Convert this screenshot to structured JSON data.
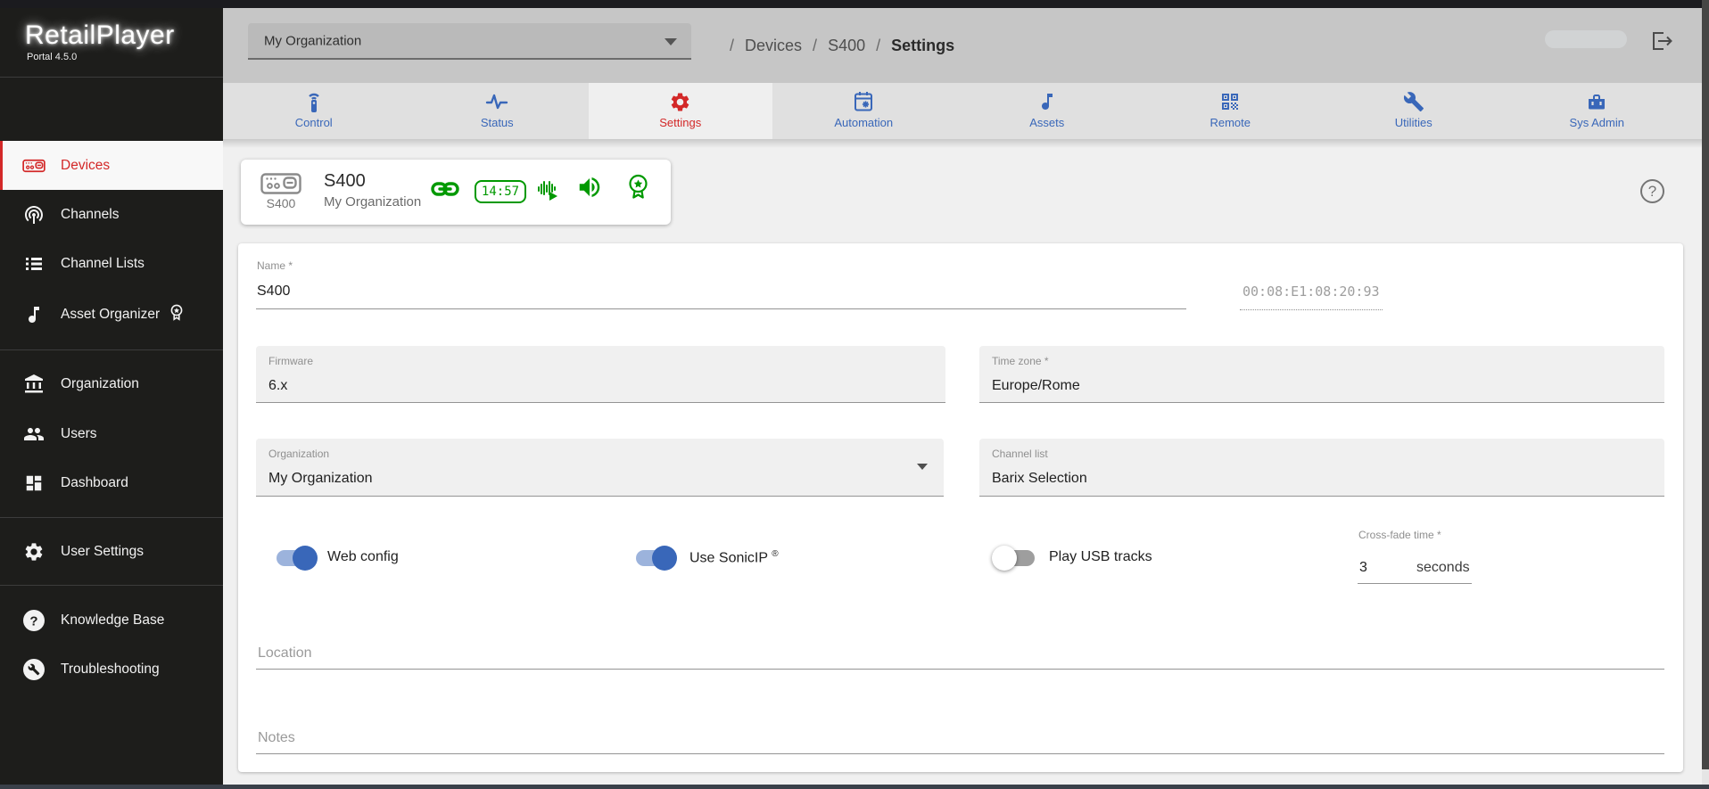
{
  "brand": {
    "name": "RetailPlayer",
    "version": "Portal 4.5.0"
  },
  "sidebar": {
    "items": [
      {
        "label": "Devices",
        "icon": "devices",
        "active": true
      },
      {
        "label": "Channels",
        "icon": "channels"
      },
      {
        "label": "Channel Lists",
        "icon": "channel-lists"
      },
      {
        "label": "Asset Organizer",
        "icon": "asset-organizer",
        "badge": "premium"
      },
      {
        "label": "Organization",
        "icon": "organization"
      },
      {
        "label": "Users",
        "icon": "users"
      },
      {
        "label": "Dashboard",
        "icon": "dashboard"
      },
      {
        "label": "User Settings",
        "icon": "user-settings"
      },
      {
        "label": "Knowledge Base",
        "icon": "knowledge-base"
      },
      {
        "label": "Troubleshooting",
        "icon": "troubleshooting"
      }
    ]
  },
  "topbar": {
    "org_selector": {
      "value": "My Organization"
    },
    "breadcrumb": {
      "sep": "/",
      "items": [
        "Devices",
        "S400",
        "Settings"
      ]
    }
  },
  "tabs": {
    "active": "Settings",
    "items": [
      {
        "label": "Control",
        "icon": "remote-control"
      },
      {
        "label": "Status",
        "icon": "pulse"
      },
      {
        "label": "Settings",
        "icon": "gear"
      },
      {
        "label": "Automation",
        "icon": "calendar-gear"
      },
      {
        "label": "Assets",
        "icon": "music-note"
      },
      {
        "label": "Remote",
        "icon": "qr-code"
      },
      {
        "label": "Utilities",
        "icon": "wrench"
      },
      {
        "label": "Sys Admin",
        "icon": "toolbox"
      }
    ]
  },
  "device_card": {
    "icon_caption": "S400",
    "title": "S400",
    "subtitle": "My Organization",
    "clock": "14:57",
    "status_icons": [
      "link",
      "clock",
      "voice",
      "speaker",
      "certificate"
    ]
  },
  "form": {
    "name": {
      "label": "Name *",
      "value": "S400"
    },
    "mac": {
      "value": "00:08:E1:08:20:93"
    },
    "firmware": {
      "label": "Firmware",
      "value": "6.x"
    },
    "timezone": {
      "label": "Time zone *",
      "value": "Europe/Rome"
    },
    "organization": {
      "label": "Organization",
      "value": "My Organization"
    },
    "channel_list": {
      "label": "Channel list",
      "value": "Barix Selection"
    },
    "toggles": [
      {
        "label": "Web config",
        "state": "on"
      },
      {
        "label": "Use SonicIP",
        "reg": "®",
        "state": "on"
      },
      {
        "label": "Play USB tracks",
        "state": "off"
      }
    ],
    "crossfade": {
      "label": "Cross-fade time *",
      "value": "3",
      "unit": "seconds"
    },
    "location": {
      "placeholder": "Location"
    },
    "notes": {
      "placeholder": "Notes"
    }
  },
  "colors": {
    "accent_red": "#d32828",
    "accent_blue": "#3967b9",
    "status_green": "#009900"
  }
}
